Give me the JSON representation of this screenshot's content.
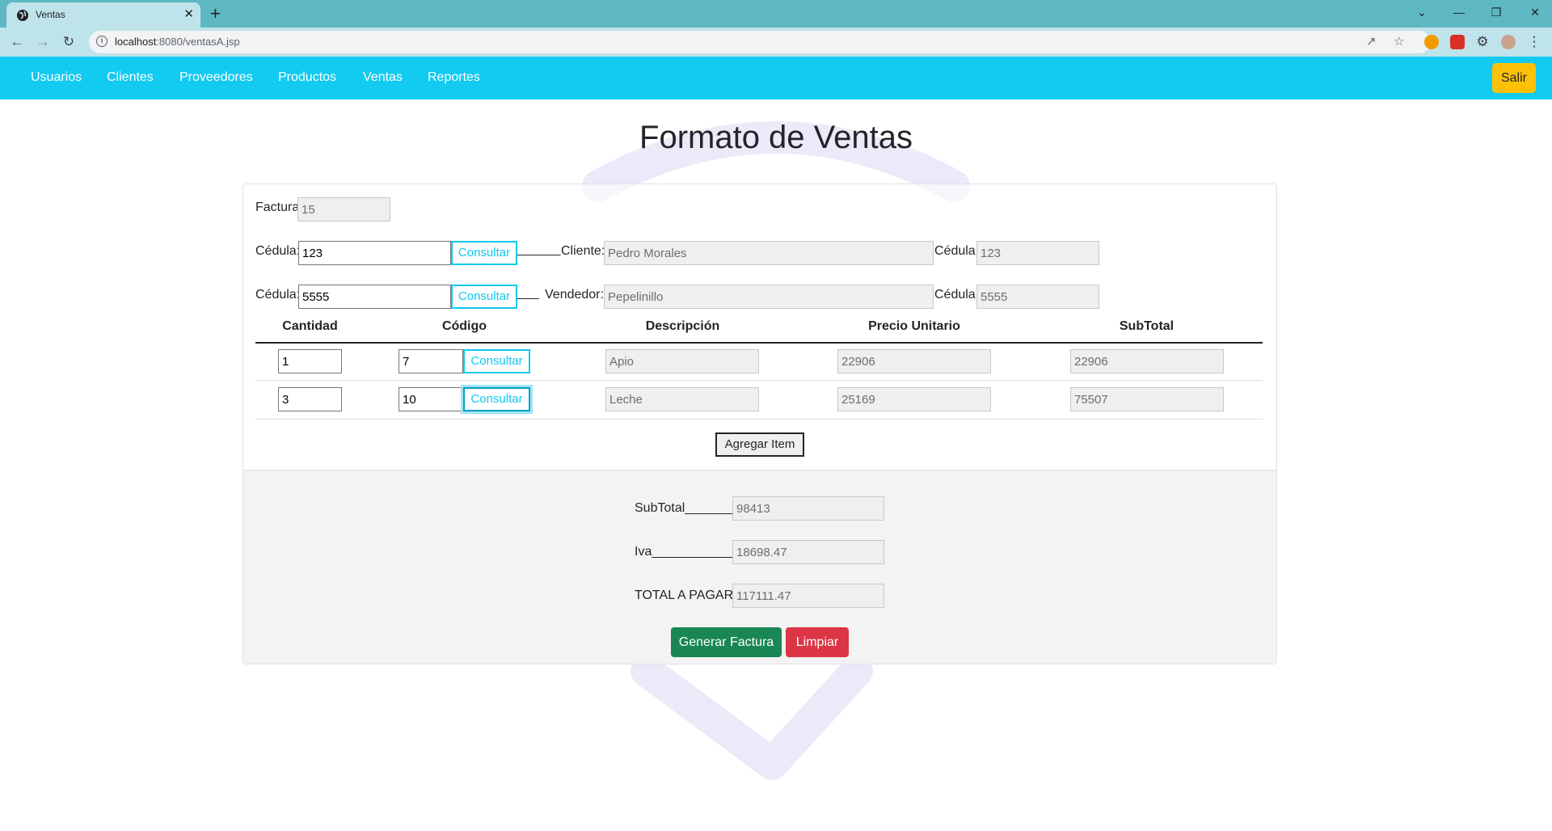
{
  "browser": {
    "tab_title": "Ventas",
    "tab_close": "✕",
    "new_tab": "+",
    "url_host": "localhost",
    "url_path": ":8080/ventasA.jsp",
    "win_min": "—",
    "win_restore": "❐",
    "win_close": "✕",
    "win_chevron": "⌄",
    "icons": [
      "back-icon",
      "forward-icon",
      "reload-icon",
      "info-icon",
      "share-icon",
      "star-icon",
      "extensions-icon",
      "profile-icon",
      "menu-icon"
    ]
  },
  "navbar": {
    "items": [
      "Usuarios",
      "Clientes",
      "Proveedores",
      "Productos",
      "Ventas",
      "Reportes"
    ],
    "salir": "Salir",
    "color": "#13caf0"
  },
  "title": "Formato de Ventas",
  "form": {
    "factura_label": "Factura",
    "factura_value": "15",
    "cliente_row": {
      "cedula_label": "Cédula:",
      "cedula_value": "123",
      "consultar": "Consultar",
      "sep": "______",
      "nombre_label": "Cliente:",
      "nombre_value": "Pedro Morales",
      "cedula2_label": "Cédula:",
      "cedula2_value": "123"
    },
    "vendedor_row": {
      "cedula_label": "Cédula:",
      "cedula_value": "5555",
      "consultar": "Consultar",
      "sep": "___",
      "nombre_label": "Vendedor:",
      "nombre_value": "Pepelinillo",
      "cedula2_label": "Cédula:",
      "cedula2_value": "5555"
    }
  },
  "table": {
    "headers": [
      "Cantidad",
      "Código",
      "Descripción",
      "Precio Unitario",
      "SubTotal"
    ],
    "rows": [
      {
        "cantidad": "1",
        "codigo": "7",
        "consultar": "Consultar",
        "descripcion": "Apio",
        "precio": "22906",
        "subtotal": "22906"
      },
      {
        "cantidad": "3",
        "codigo": "10",
        "consultar": "Consultar",
        "descripcion": "Leche",
        "precio": "25169",
        "subtotal": "75507"
      }
    ],
    "add_item": "Agregar Item"
  },
  "totals": {
    "subtotal_label": "SubTotal_______:",
    "subtotal_value": "98413",
    "iva_label": "Iva____________:",
    "iva_value": "18698.47",
    "total_label": "TOTAL A PAGAR:",
    "total_value": "117111.47"
  },
  "actions": {
    "generar": "Generar Factura",
    "limpiar": "Limpiar"
  }
}
